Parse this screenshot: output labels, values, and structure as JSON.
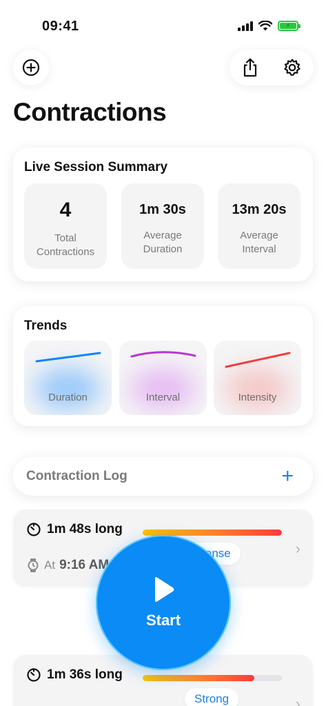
{
  "status_bar": {
    "time": "09:41"
  },
  "header": {
    "title": "Contractions"
  },
  "summary": {
    "title": "Live Session Summary",
    "stats": [
      {
        "value": "4",
        "label": "Total Contractions"
      },
      {
        "value": "1m 30s",
        "label": "Average Duration"
      },
      {
        "value": "13m 20s",
        "label": "Average Interval"
      }
    ]
  },
  "trends": {
    "title": "Trends",
    "items": [
      {
        "label": "Duration",
        "color": "#0a84ff"
      },
      {
        "label": "Interval",
        "color": "#b735d8"
      },
      {
        "label": "Intensity",
        "color": "#f23b3b"
      }
    ]
  },
  "log": {
    "title": "Contraction Log",
    "add_label": "+"
  },
  "entries": [
    {
      "length": "1m 48s long",
      "at_prefix": "At",
      "time": "9:16 AM",
      "intensity": "Intense",
      "bar_fraction": 1.0
    },
    {
      "length": "1m 36s long",
      "intensity": "Strong",
      "bar_fraction": 0.8
    }
  ],
  "start_button": {
    "label": "Start"
  }
}
